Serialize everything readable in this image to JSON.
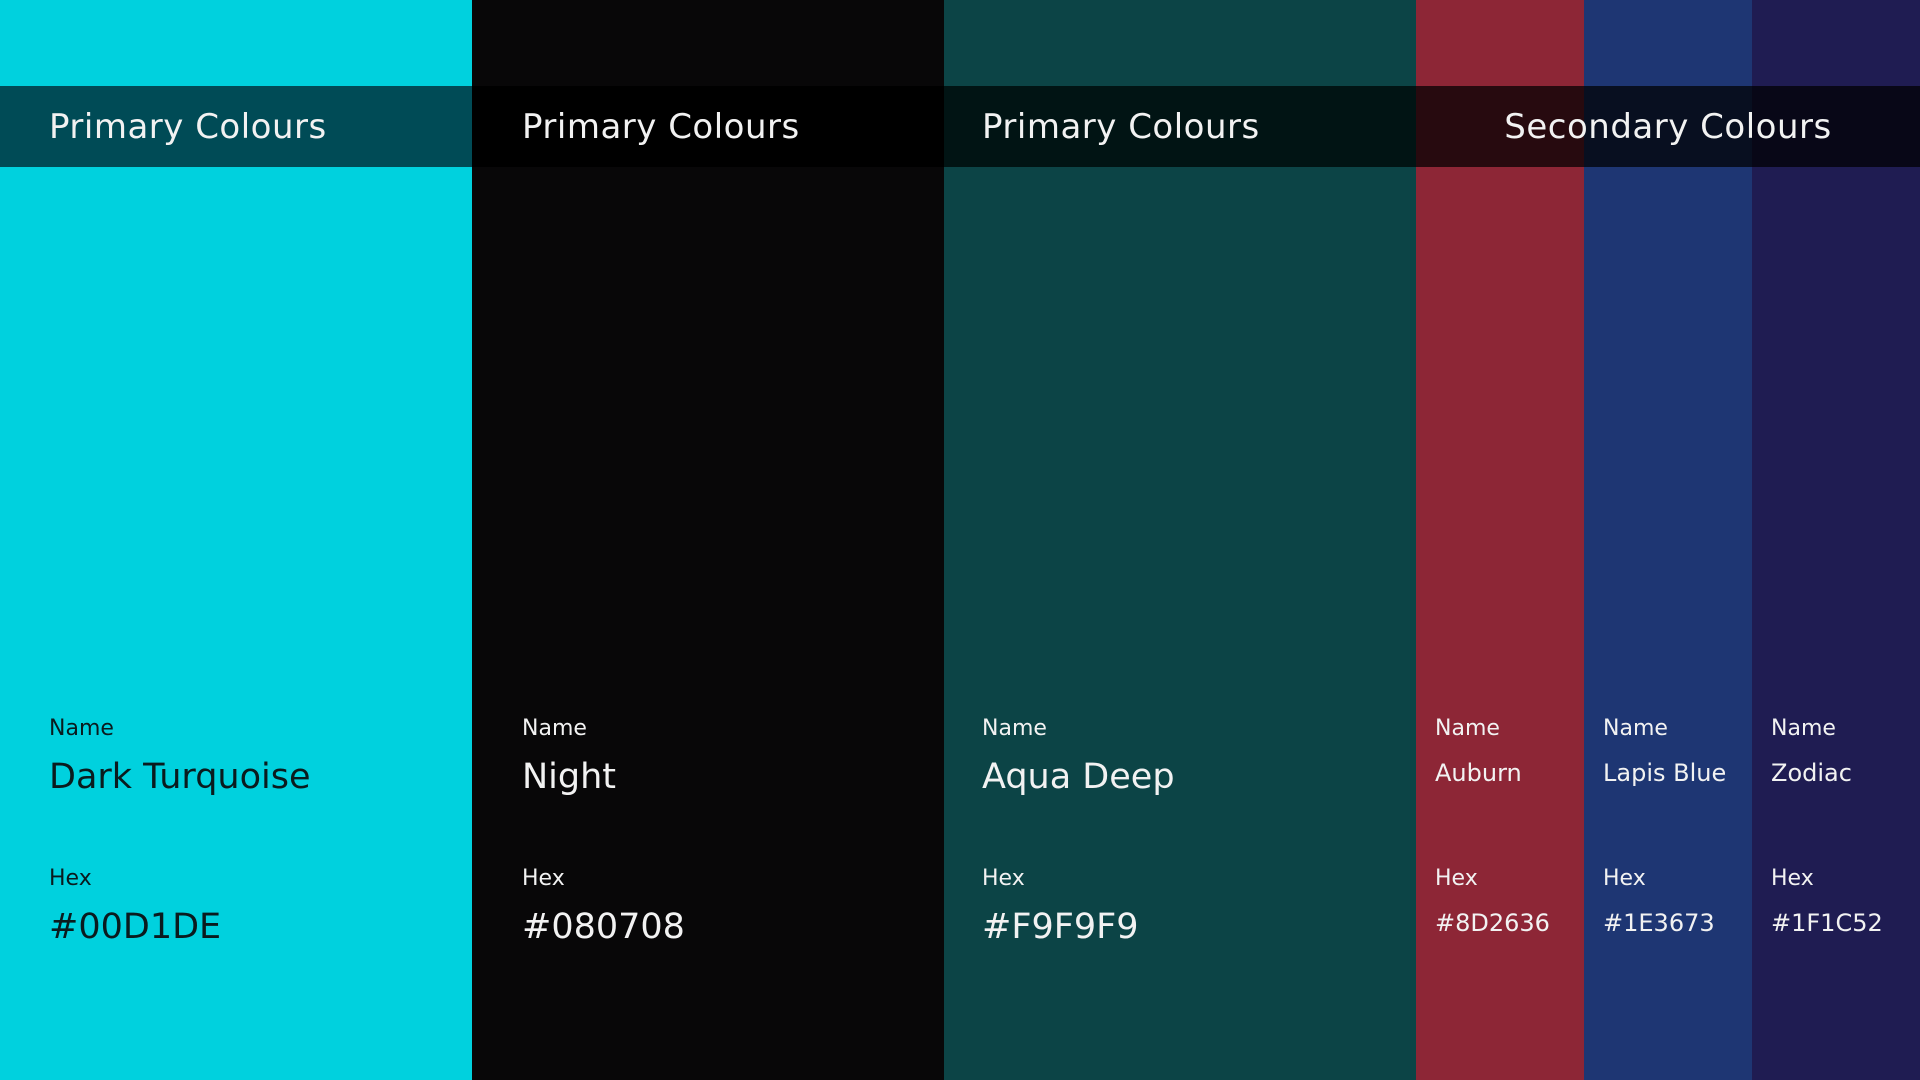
{
  "primary_title": "Primary Colours",
  "secondary_title": "Secondary Colours",
  "labels": {
    "name": "Name",
    "hex": "Hex"
  },
  "swatches": [
    {
      "name": "Dark Turquoise",
      "hex": "#00D1DE",
      "color": "#00D1DE",
      "text_color": "#0A1B1E",
      "group": "primary"
    },
    {
      "name": "Night",
      "hex": "#080708",
      "color": "#080708",
      "text_color": "#F2F2F2",
      "group": "primary"
    },
    {
      "name": "Aqua Deep",
      "hex": "#F9F9F9",
      "color": "#0C4446",
      "text_color": "#F2F2F2",
      "group": "primary"
    },
    {
      "name": "Auburn",
      "hex": "#8D2636",
      "color": "#8D2636",
      "text_color": "#F2F2F2",
      "group": "secondary"
    },
    {
      "name": "Lapis Blue",
      "hex": "#1E3673",
      "color": "#1E3673",
      "text_color": "#F2F2F2",
      "group": "secondary"
    },
    {
      "name": "Zodiac",
      "hex": "#1F1C52",
      "color": "#1F1C52",
      "text_color": "#F2F2F2",
      "group": "secondary"
    }
  ]
}
